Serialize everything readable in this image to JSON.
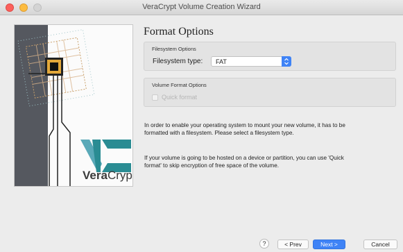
{
  "window": {
    "title": "VeraCrypt Volume Creation Wizard"
  },
  "sidebar": {
    "brand_prefix": "Vera",
    "brand_suffix": "Crypt"
  },
  "page": {
    "heading": "Format Options"
  },
  "filesystem_options": {
    "group_label": "Filesystem Options",
    "type_label": "Filesystem type:",
    "type_value": "FAT"
  },
  "volume_format_options": {
    "group_label": "Volume Format Options",
    "quick_format_label": "Quick format",
    "quick_format_checked": false
  },
  "info": {
    "paragraph1": "In order to enable your operating system to mount your new volume, it has to be formatted with a filesystem. Please select a filesystem type.",
    "paragraph2": "If your volume is going to be hosted on a device or partition, you can use 'Quick format' to skip encryption of free space of the volume."
  },
  "buttons": {
    "help": "?",
    "prev": "< Prev",
    "next": "Next >",
    "cancel": "Cancel"
  },
  "colors": {
    "accent": "#3f83f6",
    "panel": "#55585f",
    "logo_teal": "#2a8c93",
    "chip": "#e3a83a"
  }
}
